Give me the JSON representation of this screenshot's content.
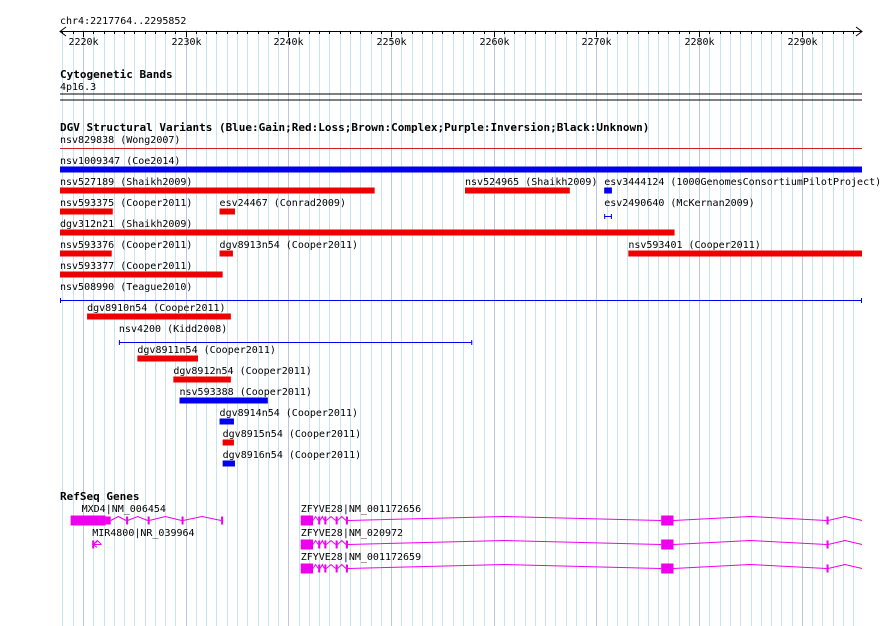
{
  "coordinates": "chr4:2217764..2295852",
  "ruler": {
    "start": 2217764,
    "end": 2295852,
    "ticks": [
      {
        "pos": 2220000,
        "label": "2220k"
      },
      {
        "pos": 2230000,
        "label": "2230k"
      },
      {
        "pos": 2240000,
        "label": "2240k"
      },
      {
        "pos": 2250000,
        "label": "2250k"
      },
      {
        "pos": 2260000,
        "label": "2260k"
      },
      {
        "pos": 2270000,
        "label": "2270k"
      },
      {
        "pos": 2280000,
        "label": "2280k"
      },
      {
        "pos": 2290000,
        "label": "2290k"
      }
    ]
  },
  "cytoband_track": {
    "title": "Cytogenetic Bands",
    "band": "4p16.3"
  },
  "sv_track": {
    "title": "DGV Structural Variants (Blue:Gain;Red:Loss;Brown:Complex;Purple:Inversion;Black:Unknown)",
    "colors": {
      "gain": "#0000ee",
      "loss": "#ee0000",
      "unknown_line": "#0000ee",
      "thin_loss": "#cc2222"
    },
    "variants": [
      {
        "id": "nsv829838",
        "label": "nsv829838 (Wong2007)",
        "start": 2217764,
        "end": 2295852,
        "type": "loss",
        "style": "thin",
        "row": 0
      },
      {
        "id": "nsv1009347",
        "label": "nsv1009347 (Coe2014)",
        "start": 2217764,
        "end": 2295852,
        "type": "gain",
        "style": "bar",
        "row": 1
      },
      {
        "id": "nsv527189",
        "label": "nsv527189 (Shaikh2009)",
        "start": 2217764,
        "end": 2248400,
        "type": "loss",
        "style": "bar",
        "row": 2
      },
      {
        "id": "nsv524965",
        "label": "nsv524965 (Shaikh2009)",
        "start": 2257200,
        "end": 2267400,
        "type": "loss",
        "style": "bar",
        "row": 2
      },
      {
        "id": "esv3444124",
        "label": "esv3444124 (1000GenomesConsortiumPilotProject)",
        "start": 2270750,
        "end": 2271500,
        "type": "gain",
        "style": "bar",
        "row": 2
      },
      {
        "id": "nsv593375",
        "label": "nsv593375 (Cooper2011)",
        "start": 2217764,
        "end": 2222900,
        "type": "loss",
        "style": "bar",
        "row": 3
      },
      {
        "id": "esv24467",
        "label": "esv24467 (Conrad2009)",
        "start": 2233300,
        "end": 2234800,
        "type": "loss",
        "style": "bar",
        "row": 3
      },
      {
        "id": "esv2490640",
        "label": "esv2490640 (McKernan2009)",
        "start": 2270750,
        "end": 2271500,
        "type": "gain",
        "style": "line",
        "row": 3
      },
      {
        "id": "dgv312n21",
        "label": "dgv312n21 (Shaikh2009)",
        "start": 2217764,
        "end": 2277600,
        "type": "loss",
        "style": "bar",
        "row": 4
      },
      {
        "id": "nsv593376",
        "label": "nsv593376 (Cooper2011)",
        "start": 2217764,
        "end": 2222800,
        "type": "loss",
        "style": "bar",
        "row": 5
      },
      {
        "id": "dgv8913n54",
        "label": "dgv8913n54 (Cooper2011)",
        "start": 2233300,
        "end": 2234600,
        "type": "loss",
        "style": "bar",
        "row": 5
      },
      {
        "id": "nsv593401",
        "label": "nsv593401 (Cooper2011)",
        "start": 2273100,
        "end": 2295852,
        "type": "loss",
        "style": "bar",
        "row": 5
      },
      {
        "id": "nsv593377",
        "label": "nsv593377 (Cooper2011)",
        "start": 2217764,
        "end": 2233600,
        "type": "loss",
        "style": "bar",
        "row": 6
      },
      {
        "id": "nsv508990",
        "label": "nsv508990 (Teague2010)",
        "start": 2217764,
        "end": 2295852,
        "type": "gain",
        "style": "line",
        "row": 7
      },
      {
        "id": "dgv8910n54",
        "label": "dgv8910n54 (Cooper2011)",
        "start": 2220400,
        "end": 2234400,
        "type": "loss",
        "style": "bar",
        "row": 8
      },
      {
        "id": "nsv4200",
        "label": "nsv4200 (Kidd2008)",
        "start": 2223500,
        "end": 2257900,
        "type": "gain",
        "style": "line",
        "row": 9
      },
      {
        "id": "dgv8911n54",
        "label": "dgv8911n54 (Cooper2011)",
        "start": 2225300,
        "end": 2231200,
        "type": "loss",
        "style": "bar",
        "row": 10
      },
      {
        "id": "dgv8912n54",
        "label": "dgv8912n54 (Cooper2011)",
        "start": 2228800,
        "end": 2234400,
        "type": "loss",
        "style": "bar",
        "row": 11
      },
      {
        "id": "nsv593388",
        "label": "nsv593388 (Cooper2011)",
        "start": 2229400,
        "end": 2238000,
        "type": "gain",
        "style": "bar",
        "row": 12
      },
      {
        "id": "dgv8914n54",
        "label": "dgv8914n54 (Cooper2011)",
        "start": 2233300,
        "end": 2234700,
        "type": "gain",
        "style": "bar",
        "row": 13
      },
      {
        "id": "dgv8915n54",
        "label": "dgv8915n54 (Cooper2011)",
        "start": 2233600,
        "end": 2234700,
        "type": "loss",
        "style": "bar",
        "row": 14
      },
      {
        "id": "dgv8916n54",
        "label": "dgv8916n54 (Cooper2011)",
        "start": 2233600,
        "end": 2234800,
        "type": "gain",
        "style": "bar",
        "row": 15
      }
    ]
  },
  "refseq_track": {
    "title": "RefSeq Genes",
    "color": "#ee00ee",
    "genes": [
      {
        "id": "MXD4",
        "label": "MXD4|NM_006454",
        "start": 2218800,
        "end": 2233600,
        "row": 0,
        "exons": [
          [
            2218800,
            2222200,
            "tall"
          ],
          [
            2222200,
            2222700,
            "short"
          ],
          [
            2224200,
            2224350,
            "short"
          ],
          [
            2226300,
            2226450,
            "short"
          ],
          [
            2229600,
            2229750,
            "short"
          ],
          [
            2233450,
            2233600,
            "short"
          ]
        ]
      },
      {
        "id": "ZFYVE28-1",
        "label": "ZFYVE28|NM_001172656",
        "start": 2241200,
        "end": 2295852,
        "row": 0,
        "exons": [
          [
            2241200,
            2242400,
            "tall"
          ],
          [
            2242900,
            2243100,
            "short"
          ],
          [
            2243500,
            2243700,
            "short"
          ],
          [
            2244600,
            2244800,
            "short"
          ],
          [
            2245600,
            2245800,
            "short"
          ],
          [
            2276300,
            2277500,
            "tall"
          ],
          [
            2292400,
            2292550,
            "short"
          ]
        ]
      },
      {
        "id": "MIR4800",
        "label": "MIR4800|NR_039964",
        "start": 2220900,
        "end": 2221800,
        "row": 1,
        "exons": [
          [
            2220900,
            2221000,
            "short"
          ]
        ]
      },
      {
        "id": "ZFYVE28-2",
        "label": "ZFYVE28|NM_020972",
        "start": 2241200,
        "end": 2295852,
        "row": 1,
        "exons": [
          [
            2241200,
            2242400,
            "tall"
          ],
          [
            2242900,
            2243100,
            "short"
          ],
          [
            2243500,
            2243700,
            "short"
          ],
          [
            2244600,
            2244800,
            "short"
          ],
          [
            2245600,
            2245800,
            "short"
          ],
          [
            2276300,
            2277500,
            "tall"
          ],
          [
            2292400,
            2292550,
            "short"
          ]
        ]
      },
      {
        "id": "ZFYVE28-3",
        "label": "ZFYVE28|NM_001172659",
        "start": 2241200,
        "end": 2295852,
        "row": 2,
        "exons": [
          [
            2241200,
            2242400,
            "tall"
          ],
          [
            2242900,
            2243100,
            "short"
          ],
          [
            2243500,
            2243700,
            "short"
          ],
          [
            2244600,
            2244800,
            "short"
          ],
          [
            2245600,
            2245800,
            "short"
          ],
          [
            2276300,
            2277500,
            "tall"
          ],
          [
            2292400,
            2292550,
            "short"
          ]
        ]
      }
    ]
  }
}
